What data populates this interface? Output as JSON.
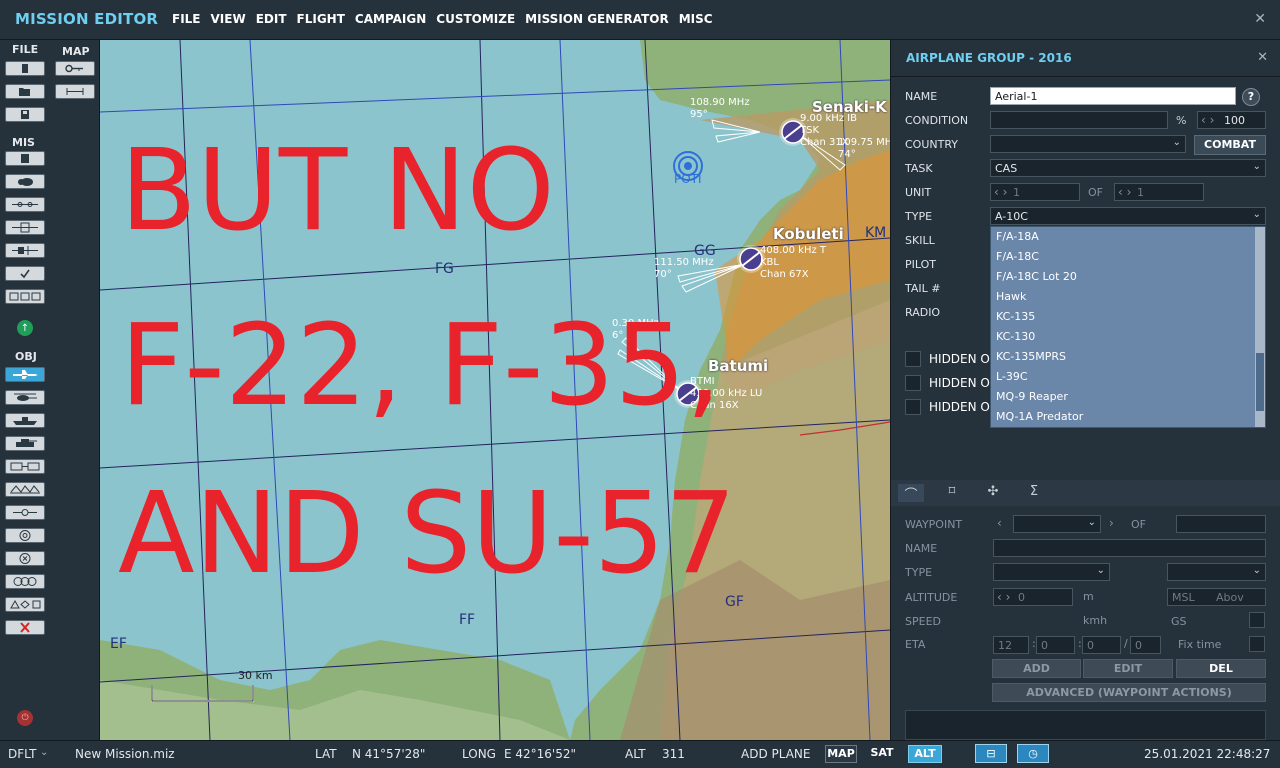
{
  "app": {
    "title": "MISSION EDITOR",
    "menu": [
      "FILE",
      "VIEW",
      "EDIT",
      "FLIGHT",
      "CAMPAIGN",
      "CUSTOMIZE",
      "MISSION GENERATOR",
      "MISC"
    ],
    "close_glyph": "✕"
  },
  "toolbar": {
    "file_label": "FILE",
    "map_label": "MAP",
    "mis_label": "MIS",
    "obj_label": "OBJ",
    "file_icons": [
      "new-file-icon",
      "open-folder-icon",
      "save-disk-icon"
    ],
    "map_icons": [
      "map-options-icon",
      "ruler-icon"
    ],
    "mis_icons": [
      "briefing-icon",
      "weather-icon",
      "triggers-icon",
      "resources-icon",
      "goals-icon",
      "check-icon",
      "groups-icon"
    ],
    "obj_icons": [
      "airplane-icon",
      "helicopter-icon",
      "ship-icon",
      "vehicle-icon",
      "static-object-icon",
      "template-icon",
      "route-icon",
      "zone-icon",
      "target-icon",
      "formation-icon",
      "shapes-icon",
      "delete-icon"
    ]
  },
  "map": {
    "overlay_lines": [
      "BUT NO",
      "F-22, F-35,",
      "AND SU-57"
    ],
    "grid_labels": [
      "FG",
      "GG",
      "KM",
      "FF",
      "GF",
      "EF"
    ],
    "cities": [
      "Senaki-K",
      "Kobuleti",
      "Batumi"
    ],
    "poti_label": "POTI",
    "freqs": {
      "senaki_left": [
        "108.90 MHz",
        "95°"
      ],
      "senaki_right": [
        "9.00 kHz IB",
        "TSK",
        "Chan 31X",
        "109.75 MHz",
        "74°"
      ],
      "kobuleti_left": [
        "111.50 MHz",
        "70°"
      ],
      "kobuleti_right": [
        "408.00 kHz T",
        "KBL",
        "Chan 67X"
      ],
      "batumi_left": [
        "0.30 MHz",
        "6°"
      ],
      "batumi_right": [
        "BTMI",
        "430.00 kHz LU",
        "Chan 16X"
      ]
    },
    "scale_label": "30 km"
  },
  "panel": {
    "title": "AIRPLANE GROUP - 2016",
    "close_glyph": "✕",
    "labels": {
      "name": "NAME",
      "condition": "CONDITION",
      "country": "COUNTRY",
      "task": "TASK",
      "unit": "UNIT",
      "type": "TYPE",
      "skill": "SKILL",
      "pilot": "PILOT",
      "tail": "TAIL #",
      "radio": "RADIO"
    },
    "name_value": "Aerial-1",
    "help_glyph": "?",
    "condition_value": "",
    "percent": "%",
    "probability": "100",
    "country_value": "",
    "combat_label": "COMBAT",
    "task_value": "CAS",
    "unit_value": "1",
    "unit_of": "OF",
    "unit_total": "1",
    "type_value": "A-10C",
    "type_options": [
      "F/A-18A",
      "F/A-18C",
      "F/A-18C Lot 20",
      "Hawk",
      "KC-135",
      "KC-130",
      "KC-135MPRS",
      "L-39C",
      "MQ-9 Reaper",
      "MQ-1A Predator"
    ],
    "hidden_labels": [
      "HIDDEN ON",
      "HIDDEN ON",
      "HIDDEN ON"
    ],
    "tabs": [
      "route-icon",
      "trigger-icon",
      "payload-icon",
      "summary-icon"
    ],
    "waypoint": {
      "waypoint": "WAYPOINT",
      "of": "OF",
      "name": "NAME",
      "type": "TYPE",
      "altitude": "ALTITUDE",
      "alt_value": "0",
      "alt_unit": "m",
      "alt_ref": "MSL",
      "alt_ref2": "Abov",
      "speed": "SPEED",
      "speed_unit": "kmh",
      "gs": "GS",
      "eta": "ETA",
      "eta_h": "12",
      "eta_m": "0",
      "eta_s": "0",
      "eta_d": "0",
      "fix_time": "Fix time"
    },
    "buttons": {
      "add": "ADD",
      "edit": "EDIT",
      "del": "DEL",
      "advanced": "ADVANCED (WAYPOINT ACTIONS)"
    }
  },
  "status": {
    "layout": "DFLT",
    "mission_file": "New Mission.miz",
    "lat_label": "LAT",
    "lat_value": "N 41°57'28\"",
    "long_label": "LONG",
    "long_value": "E 42°16'52\"",
    "alt_label": "ALT",
    "alt_value": "311",
    "mode": "ADD PLANE",
    "map_btn": "MAP",
    "sat_btn": "SAT",
    "alt_btn": "ALT",
    "datetime": "25.01.2021 22:48:27"
  },
  "colors": {
    "accent": "#6fcff0",
    "overlay_text": "#e8232b",
    "sea": "#8cc4cd",
    "dropdown": "#6a86a8"
  }
}
